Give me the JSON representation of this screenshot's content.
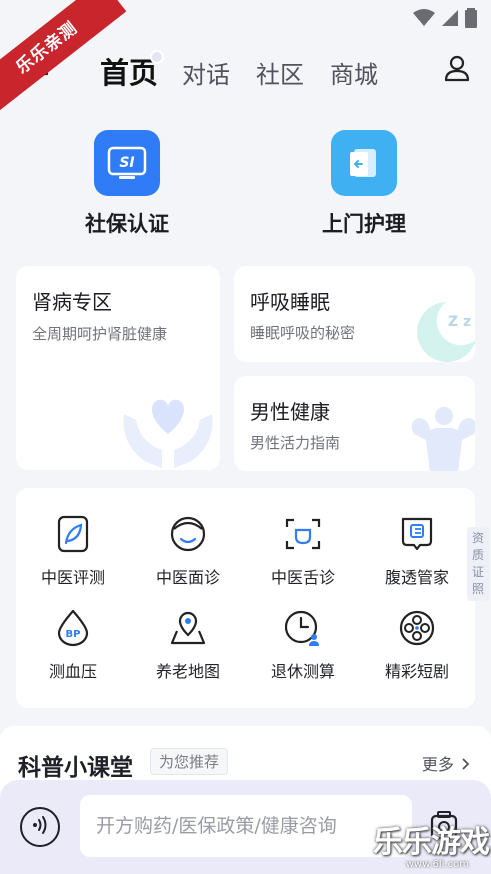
{
  "ribbon": {
    "text": "乐乐亲测"
  },
  "nav": {
    "tabs": [
      {
        "label": "首页",
        "active": true
      },
      {
        "label": "对话",
        "active": false
      },
      {
        "label": "社区",
        "active": false
      },
      {
        "label": "商城",
        "active": false
      }
    ]
  },
  "quick": [
    {
      "label": "社保认证",
      "icon": "si-card-icon",
      "color": "#2f7cf6",
      "glyph": "SI"
    },
    {
      "label": "上门护理",
      "icon": "door-care-icon",
      "color": "#3fb1f3"
    }
  ],
  "cards": {
    "kidney": {
      "title": "肾病专区",
      "subtitle": "全周期呵护肾脏健康"
    },
    "sleep": {
      "title": "呼吸睡眠",
      "subtitle": "睡眠呼吸的秘密",
      "badge": "Z z"
    },
    "male": {
      "title": "男性健康",
      "subtitle": "男性活力指南"
    }
  },
  "services": [
    {
      "label": "中医评测",
      "icon": "tcm-assessment-icon"
    },
    {
      "label": "中医面诊",
      "icon": "face-diagnosis-icon"
    },
    {
      "label": "中医舌诊",
      "icon": "tongue-diagnosis-icon"
    },
    {
      "label": "腹透管家",
      "icon": "dialysis-manager-icon"
    },
    {
      "label": "测血压",
      "icon": "blood-pressure-icon",
      "glyph": "BP"
    },
    {
      "label": "养老地图",
      "icon": "elderly-map-icon"
    },
    {
      "label": "退休测算",
      "icon": "retirement-calc-icon"
    },
    {
      "label": "精彩短剧",
      "icon": "film-reel-icon"
    }
  ],
  "side_tag": {
    "text": "资质证照"
  },
  "classroom": {
    "title": "科普小课堂",
    "tag": "为您推荐",
    "more": "更多"
  },
  "chat": {
    "placeholder": "开方购药/医保政策/健康咨询"
  },
  "watermark": {
    "text": "乐乐游戏",
    "url": "www.6ll.com"
  },
  "colors": {
    "accent": "#2f7cf6",
    "light_blue": "#3fb1f3",
    "ribbon": "#c8252c",
    "chat_bg": "#ebeaf9"
  }
}
